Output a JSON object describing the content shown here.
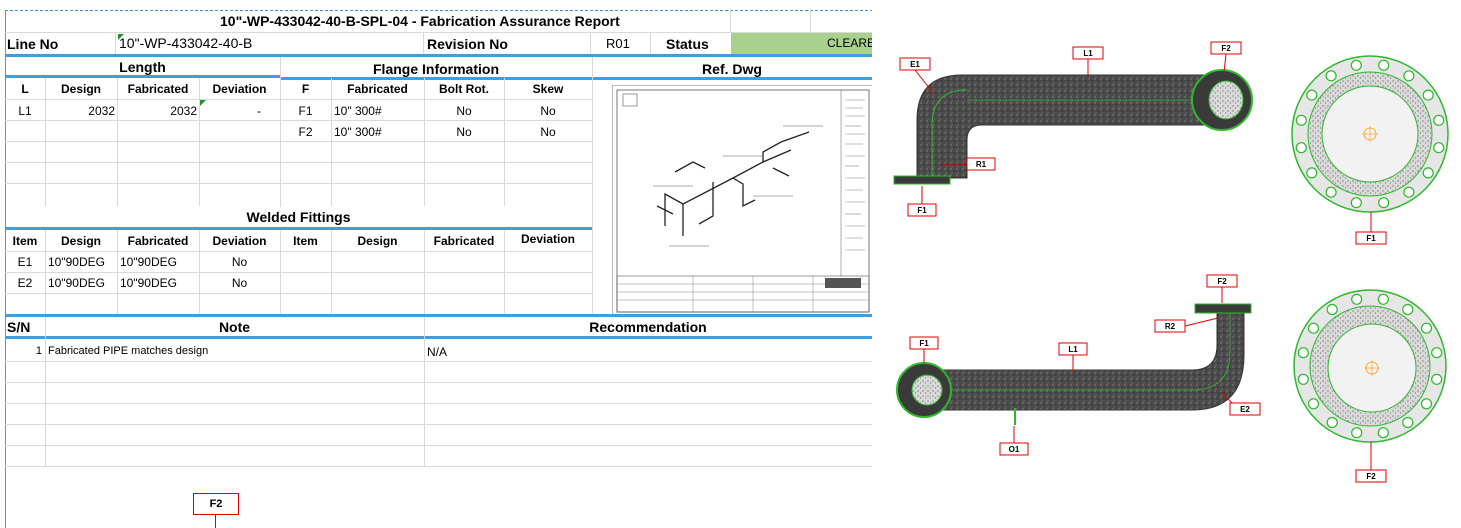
{
  "report": {
    "title_id": "10\"-WP-433042-40-B-SPL-04",
    "title_suffix": " - Fabrication Assurance Report",
    "line_no_label": "Line No",
    "line_no_value": "10\"-WP-433042-40-B",
    "revision_label": "Revision No",
    "revision_value": "R01",
    "status_label": "Status",
    "status_value": "CLEARED"
  },
  "length": {
    "section_title": "Length",
    "headers": [
      "L",
      "Design",
      "Fabricated",
      "Deviation"
    ],
    "rows": [
      {
        "l": "L1",
        "design": "2032",
        "fabricated": "2032",
        "deviation": "-"
      }
    ]
  },
  "flange": {
    "section_title": "Flange Information",
    "headers": [
      "F",
      "Fabricated",
      "Bolt Rot.",
      "Skew"
    ],
    "rows": [
      {
        "f": "F1",
        "fabricated": "10\" 300#",
        "bolt": "No",
        "skew": "No"
      },
      {
        "f": "F2",
        "fabricated": "10\" 300#",
        "bolt": "No",
        "skew": "No"
      }
    ]
  },
  "ref_dwg": {
    "section_title": "Ref. Dwg"
  },
  "welded": {
    "section_title": "Welded Fittings",
    "headers": [
      "Item",
      "Design",
      "Fabricated",
      "Deviation",
      "Item",
      "Design",
      "Fabricated",
      "Deviation"
    ],
    "rows": [
      {
        "item": "E1",
        "design": "10\"90DEG",
        "fabricated": "10\"90DEG",
        "deviation": "No"
      },
      {
        "item": "E2",
        "design": "10\"90DEG",
        "fabricated": "10\"90DEG",
        "deviation": "No"
      }
    ]
  },
  "notes": {
    "sn_label": "S/N",
    "note_label": "Note",
    "recommendation_label": "Recommendation",
    "rows": [
      {
        "sn": "1",
        "note": "Fabricated PIPE matches design",
        "recommendation": "N/A"
      }
    ]
  },
  "tags": {
    "top_view": {
      "e1": "E1",
      "l1": "L1",
      "f2": "F2",
      "r1": "R1",
      "f1": "F1",
      "face_f1": "F1"
    },
    "bottom_view": {
      "f2": "F2",
      "r2": "R2",
      "f1": "F1",
      "l1": "L1",
      "e2": "E2",
      "o1": "O1",
      "face_f2": "F2"
    },
    "overflow_f2": "F2"
  },
  "colors": {
    "status_green": "#a9d18e",
    "section_rule_blue": "#3d9ee0",
    "tag_red": "#e00000",
    "scan_green": "#2db82d"
  }
}
